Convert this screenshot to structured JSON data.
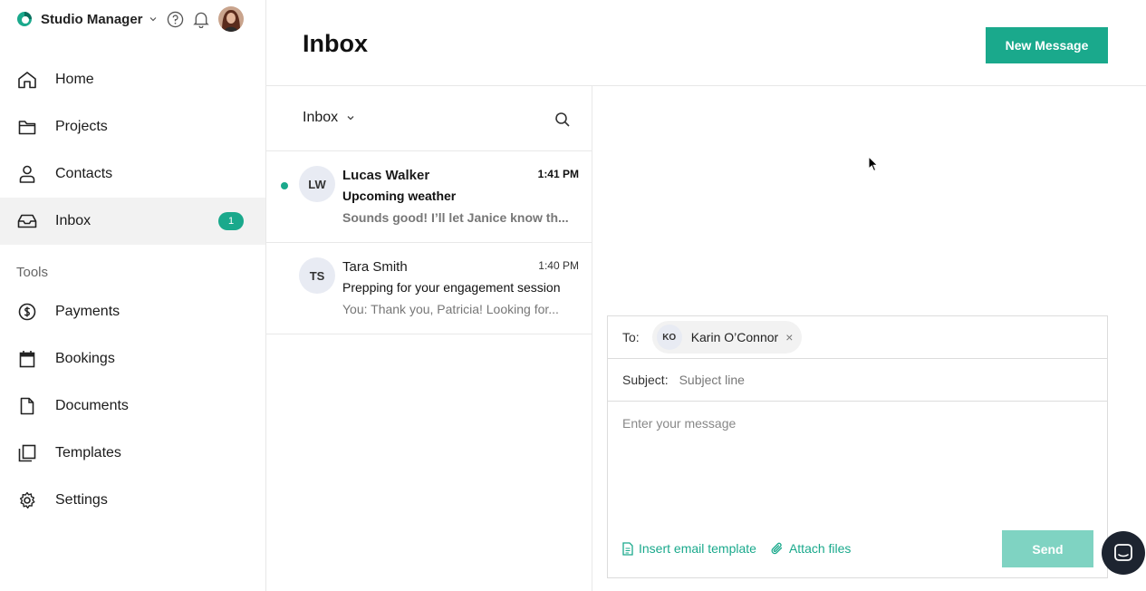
{
  "sidebar": {
    "brand": "Studio Manager",
    "nav": [
      {
        "label": "Home",
        "icon": "home-icon"
      },
      {
        "label": "Projects",
        "icon": "folder-icon"
      },
      {
        "label": "Contacts",
        "icon": "user-icon"
      },
      {
        "label": "Inbox",
        "icon": "inbox-icon",
        "badge": "1",
        "active": true
      }
    ],
    "tools_heading": "Tools",
    "tools": [
      {
        "label": "Payments",
        "icon": "dollar-icon"
      },
      {
        "label": "Bookings",
        "icon": "calendar-icon"
      },
      {
        "label": "Documents",
        "icon": "document-icon"
      },
      {
        "label": "Templates",
        "icon": "templates-icon"
      },
      {
        "label": "Settings",
        "icon": "gear-icon"
      }
    ]
  },
  "header": {
    "title": "Inbox",
    "new_message_label": "New Message"
  },
  "list": {
    "folder": "Inbox",
    "messages": [
      {
        "initials": "LW",
        "from": "Lucas Walker",
        "time": "1:41 PM",
        "subject": "Upcoming weather",
        "preview": "Sounds good! I’ll let Janice know th...",
        "unread": true
      },
      {
        "initials": "TS",
        "from": "Tara Smith",
        "time": "1:40 PM",
        "subject": "Prepping for your engagement session",
        "preview": "You: Thank you, Patricia! Looking for...",
        "unread": false
      }
    ]
  },
  "compose": {
    "to_label": "To:",
    "recipient": {
      "initials": "KO",
      "name": "Karin O’Connor",
      "remove": "×"
    },
    "subject_label": "Subject:",
    "subject_placeholder": "Subject line",
    "body_placeholder": "Enter your message",
    "insert_template_label": "Insert email template",
    "attach_files_label": "Attach files",
    "send_label": "Send"
  },
  "colors": {
    "accent": "#1aa98c",
    "send_disabled": "#7fd3c2"
  }
}
